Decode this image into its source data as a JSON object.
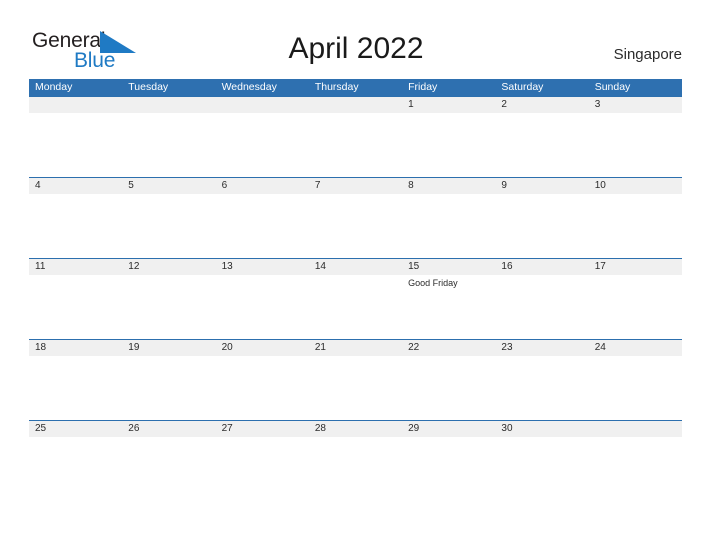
{
  "brand": {
    "word_one": "General",
    "word_two": "Blue",
    "sail_icon": "sail-triangle-icon",
    "color_dark": "#231f20",
    "color_blue": "#1f7ac4"
  },
  "header": {
    "title": "April 2022",
    "region": "Singapore"
  },
  "theme": {
    "header_blue": "#2e70b0",
    "row_band_gray": "#f0f0f0",
    "row_rule_blue": "#2c6fae",
    "text_dark": "#2b2b2b",
    "page_background": "#ffffff"
  },
  "calendar": {
    "month": "April",
    "year": "2022",
    "weekday_headers": [
      "Monday",
      "Tuesday",
      "Wednesday",
      "Thursday",
      "Friday",
      "Saturday",
      "Sunday"
    ],
    "weeks": [
      [
        {
          "day": "",
          "event": "",
          "filled": true
        },
        {
          "day": "",
          "event": "",
          "filled": true
        },
        {
          "day": "",
          "event": "",
          "filled": true
        },
        {
          "day": "",
          "event": "",
          "filled": true
        },
        {
          "day": "1",
          "event": "",
          "filled": true
        },
        {
          "day": "2",
          "event": "",
          "filled": true
        },
        {
          "day": "3",
          "event": "",
          "filled": true
        }
      ],
      [
        {
          "day": "4",
          "event": "",
          "filled": true
        },
        {
          "day": "5",
          "event": "",
          "filled": true
        },
        {
          "day": "6",
          "event": "",
          "filled": true
        },
        {
          "day": "7",
          "event": "",
          "filled": true
        },
        {
          "day": "8",
          "event": "",
          "filled": true
        },
        {
          "day": "9",
          "event": "",
          "filled": true
        },
        {
          "day": "10",
          "event": "",
          "filled": true
        }
      ],
      [
        {
          "day": "11",
          "event": "",
          "filled": true
        },
        {
          "day": "12",
          "event": "",
          "filled": true
        },
        {
          "day": "13",
          "event": "",
          "filled": true
        },
        {
          "day": "14",
          "event": "",
          "filled": true
        },
        {
          "day": "15",
          "event": "Good Friday",
          "filled": true
        },
        {
          "day": "16",
          "event": "",
          "filled": true
        },
        {
          "day": "17",
          "event": "",
          "filled": true
        }
      ],
      [
        {
          "day": "18",
          "event": "",
          "filled": true
        },
        {
          "day": "19",
          "event": "",
          "filled": true
        },
        {
          "day": "20",
          "event": "",
          "filled": true
        },
        {
          "day": "21",
          "event": "",
          "filled": true
        },
        {
          "day": "22",
          "event": "",
          "filled": true
        },
        {
          "day": "23",
          "event": "",
          "filled": true
        },
        {
          "day": "24",
          "event": "",
          "filled": true
        }
      ],
      [
        {
          "day": "25",
          "event": "",
          "filled": true
        },
        {
          "day": "26",
          "event": "",
          "filled": true
        },
        {
          "day": "27",
          "event": "",
          "filled": true
        },
        {
          "day": "28",
          "event": "",
          "filled": true
        },
        {
          "day": "29",
          "event": "",
          "filled": true
        },
        {
          "day": "30",
          "event": "",
          "filled": true
        },
        {
          "day": "",
          "event": "",
          "filled": true
        }
      ]
    ]
  }
}
